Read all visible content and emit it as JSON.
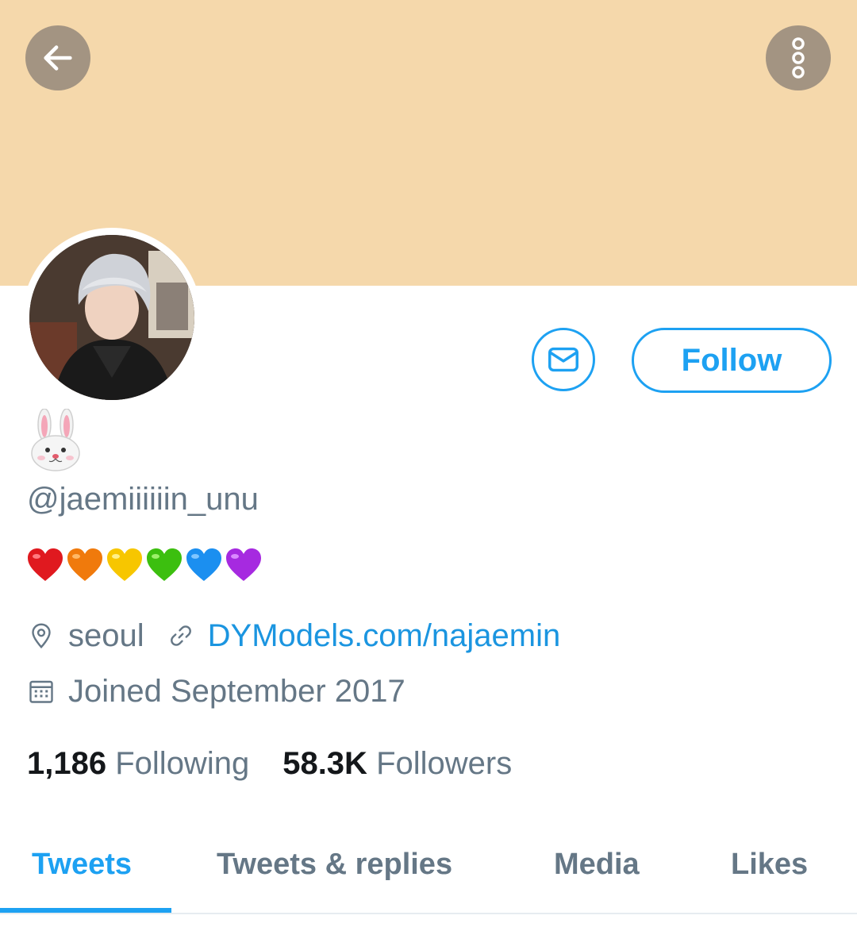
{
  "header": {
    "banner_color": "#f5d8ab",
    "back_icon": "arrow-left-icon",
    "more_icon": "more-vertical-icon"
  },
  "profile": {
    "display_name_icon": "rabbit-face-emoji",
    "handle": "@jaemiiiiiin_unu",
    "bio_icons": [
      "red-heart",
      "orange-heart",
      "yellow-heart",
      "green-heart",
      "blue-heart",
      "purple-heart"
    ],
    "location": "seoul",
    "link": "DYModels.com/najaemin",
    "joined": "Joined September 2017"
  },
  "actions": {
    "message_icon": "mail-icon",
    "follow_label": "Follow"
  },
  "stats": {
    "following_count": "1,186",
    "following_label": "Following",
    "followers_count": "58.3K",
    "followers_label": "Followers"
  },
  "tabs": [
    {
      "label": "Tweets",
      "active": true
    },
    {
      "label": "Tweets & replies",
      "active": false
    },
    {
      "label": "Media",
      "active": false
    },
    {
      "label": "Likes",
      "active": false
    }
  ],
  "colors": {
    "accent": "#1da1f2",
    "link": "#1b95e0",
    "muted": "#657786",
    "text": "#14171a"
  }
}
